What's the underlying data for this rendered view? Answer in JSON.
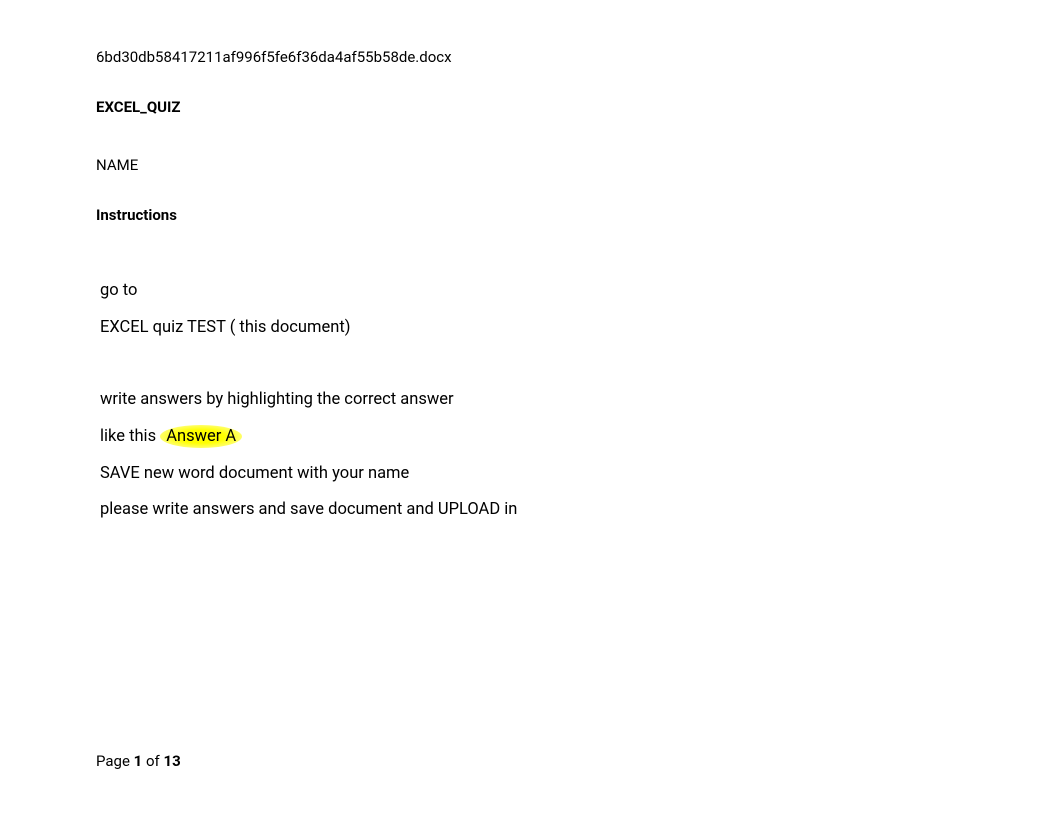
{
  "filename": "6bd30db58417211af996f5fe6f36da4af55b58de.docx",
  "title": "EXCEL_QUIZ",
  "name_label": "NAME",
  "instructions_heading": "Instructions",
  "instructions": {
    "line1": "go to",
    "line2": "EXCEL quiz TEST ( this document)",
    "line3": "write answers by highlighting the correct answer",
    "line4_prefix": "like this ",
    "line4_highlight": "Answer A",
    "line5": "SAVE new word document with your name",
    "line6": "please write answers and save document and UPLOAD in"
  },
  "footer": {
    "page_label": "Page ",
    "current": "1",
    "of_label": " of ",
    "total": "13"
  }
}
